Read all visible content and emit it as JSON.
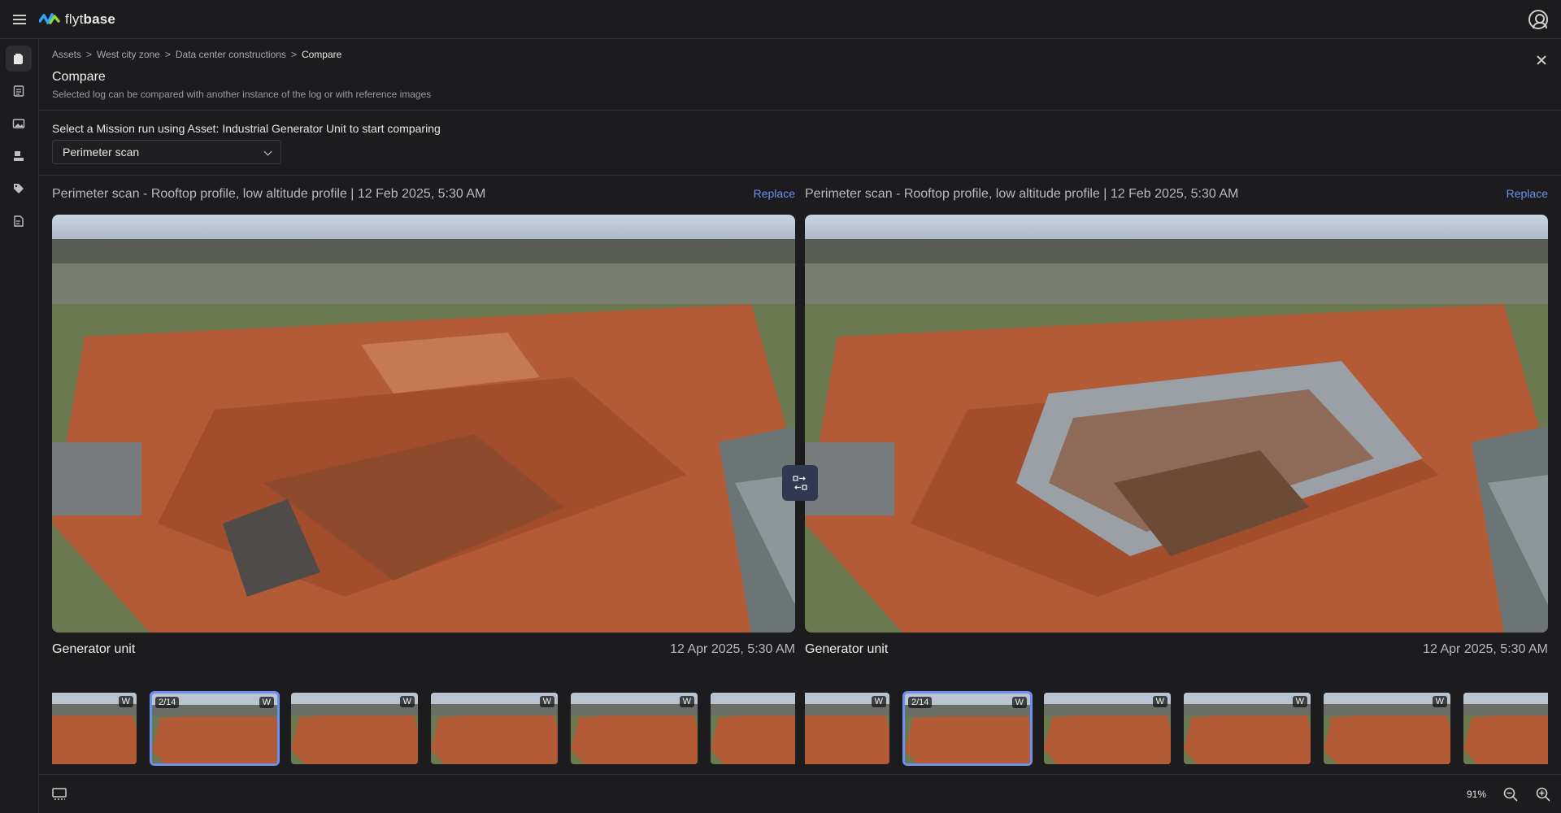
{
  "app": {
    "logo_text_light": "flyt",
    "logo_text_bold": "base"
  },
  "breadcrumb": {
    "items": [
      "Assets",
      "West city zone",
      "Data center constructions",
      "Compare"
    ],
    "sep": ">"
  },
  "header": {
    "title": "Compare",
    "subtitle": "Selected log can be compared with another instance of the log or with reference images"
  },
  "selection": {
    "prompt": "Select a Mission run using Asset: Industrial Generator Unit to start comparing",
    "dropdown_value": "Perimeter scan"
  },
  "left_panel": {
    "title": "Perimeter scan - Rooftop profile, low altitude profile | 12 Feb 2025, 5:30 AM",
    "replace_label": "Replace",
    "caption": "Generator unit",
    "date": "12 Apr 2025, 5:30 AM"
  },
  "right_panel": {
    "title": "Perimeter scan - Rooftop profile, low altitude profile | 12 Feb 2025, 5:30 AM",
    "replace_label": "Replace",
    "caption": "Generator unit",
    "date": "12 Apr 2025, 5:30 AM"
  },
  "thumbnails": {
    "badge": "W",
    "selected_counter": "2/14"
  },
  "footer": {
    "zoom": "91%"
  },
  "icons": {
    "sidebar": [
      "assets-icon",
      "logs-icon",
      "media-icon",
      "sites-icon",
      "tags-icon",
      "reports-icon"
    ],
    "swap": "compare-swap-icon"
  },
  "colors": {
    "accent": "#6f8ff0",
    "background": "#1c1c1e",
    "border": "#303033"
  }
}
